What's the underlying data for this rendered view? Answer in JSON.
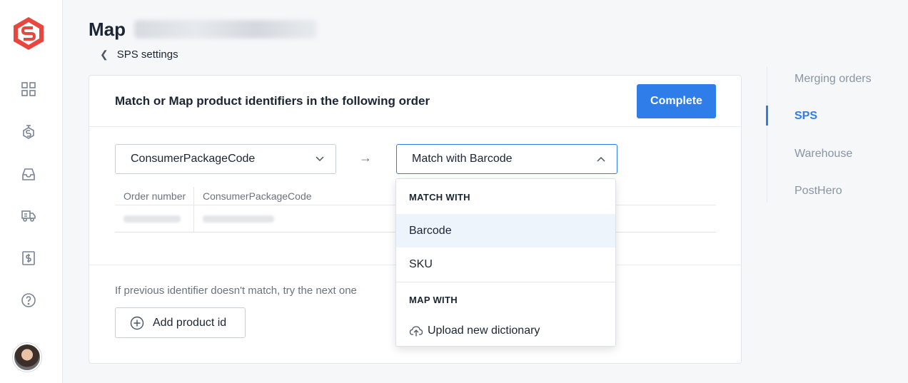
{
  "header": {
    "title": "Map",
    "back_label": "SPS settings"
  },
  "card": {
    "title": "Match or Map product identifiers in the following order",
    "complete_label": "Complete",
    "source_select_value": "ConsumerPackageCode",
    "target_select_value": "Match with Barcode",
    "table": {
      "columns": [
        "Order number",
        "ConsumerPackageCode"
      ]
    },
    "hint": "If previous identifier doesn't match, try the next one",
    "add_label": "Add product id"
  },
  "dropdown": {
    "section_match": "MATCH WITH",
    "items": [
      "Barcode",
      "SKU"
    ],
    "selected": "Barcode",
    "section_map": "MAP WITH",
    "upload_label": "Upload new dictionary"
  },
  "right_nav": {
    "items": [
      "Merging orders",
      "SPS",
      "Warehouse",
      "PostHero"
    ],
    "active": "SPS"
  },
  "colors": {
    "accent": "#2e7de9",
    "logo": "#e8473f"
  },
  "icons": {
    "rail": [
      "dashboard-icon",
      "bundle-icon",
      "inbox-icon",
      "truck-icon",
      "billing-icon",
      "help-icon"
    ]
  }
}
